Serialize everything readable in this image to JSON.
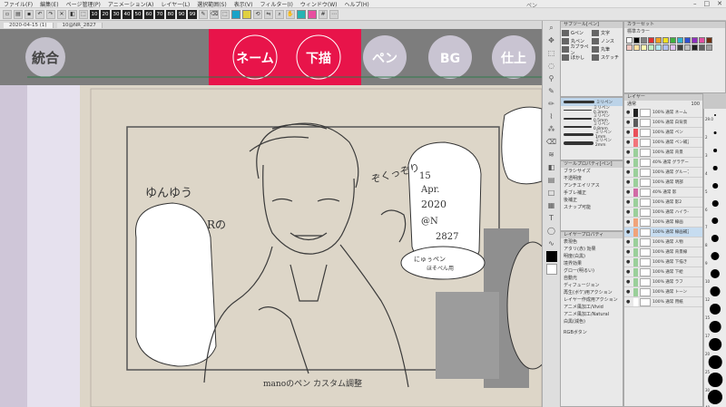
{
  "menubar": {
    "items": [
      "ファイル(F)",
      "編集(E)",
      "ページ管理(P)",
      "アニメーション(A)",
      "レイヤー(L)",
      "選択範囲(S)",
      "表示(V)",
      "フィルター(I)",
      "ウィンドウ(W)",
      "ヘルプ(H)"
    ],
    "title": "ペン"
  },
  "toolbar": {
    "brush_sizes": [
      "10",
      "20",
      "30",
      "40",
      "50",
      "60",
      "70",
      "80",
      "90",
      "99"
    ],
    "colors": {
      "fg": "#000000",
      "bg": "#ffffff"
    }
  },
  "canvas": {
    "tabs": [
      "2020-04-15 (1)",
      "10@NR_2827"
    ],
    "header_circles": [
      {
        "label": "統合",
        "active": false
      },
      {
        "label": "ネーム",
        "active": true
      },
      {
        "label": "下描",
        "active": true
      },
      {
        "label": "ペン",
        "active": false
      },
      {
        "label": "BG",
        "active": false
      },
      {
        "label": "仕上",
        "active": false
      }
    ],
    "notes": {
      "left": "ゆんゆう",
      "mid_left": "Rの",
      "top_right": "ぞくっぞり",
      "date": [
        "15",
        "Apr.",
        "2020",
        "@N",
        "2827"
      ],
      "bubble": [
        "にゅぅペン",
        "ほそぺん用"
      ],
      "bottom": "manoのペン カスタム調整"
    }
  },
  "sub_tool_panel": {
    "header": "サブツール[ペン]",
    "items": [
      {
        "label": "Gペン"
      },
      {
        "label": "文字"
      },
      {
        "label": "丸ペン"
      },
      {
        "label": "ノンス"
      },
      {
        "label": "カブラペン"
      },
      {
        "label": "丸筆"
      },
      {
        "label": "ぼかし"
      },
      {
        "label": "スケッチ"
      }
    ],
    "brushes": [
      "ミリペン",
      "ミリペン 0.3mm",
      "ミリペン 0.5mm",
      "ミリペン 0.8mm",
      "ミリペン 1mm",
      "ミリペン 2mm"
    ]
  },
  "tool_property": {
    "header": "ツールプロパティ[ペン]",
    "rows": [
      "ブラシサイズ",
      "不透明度",
      "アンチエイリアス",
      "手ブレ補正",
      "後補正",
      "スナップ可能"
    ]
  },
  "layer_property": {
    "header": "レイヤープロパティ",
    "rows": [
      "表現色",
      "アタリ(赤) 効果",
      "明度(白黒)",
      "境界効果",
      "グロー(明るい)",
      "自動光",
      "ディフュージョン",
      "再生(ボケ)用アクション",
      "レイヤー作成用アクション",
      "アニメ風加工/Vivid",
      "アニメ風加工/Natural",
      "白黒(減色)"
    ],
    "bottom": "RGBボタン"
  },
  "color_set": {
    "header": "カラーセット",
    "name": "標準カラー"
  },
  "layer_panel": {
    "header": "レイヤー",
    "blend": "通常",
    "opacity": "100",
    "layers": [
      {
        "name": "100% 通常 ネーム",
        "color": "#222222"
      },
      {
        "name": "100% 通常 白背景",
        "color": "#5b5b5b"
      },
      {
        "name": "100% 通常 ペン",
        "color": "#e94f58"
      },
      {
        "name": "100% 通常 ペン補正",
        "color": "#f2747b"
      },
      {
        "name": "100% 通常 背景",
        "color": "#9acf9a"
      },
      {
        "name": "40% 通常 グラデーション",
        "color": "#9acf9a"
      },
      {
        "name": "100% 通常 グループ",
        "color": "#9acf9a"
      },
      {
        "name": "100% 通常 明部",
        "color": "#9acf9a"
      },
      {
        "name": "40% 通常 影",
        "color": "#d16aa6"
      },
      {
        "name": "100% 通常 影2",
        "color": "#9acf9a"
      },
      {
        "name": "100% 通常 ハイライト",
        "color": "#9acf9a"
      },
      {
        "name": "100% 通常 線画",
        "color": "#f0a37a"
      },
      {
        "name": "100% 通常 線画補正",
        "color": "#f0a37a"
      },
      {
        "name": "100% 通常 人物",
        "color": "#9acf9a"
      },
      {
        "name": "100% 通常 背景線",
        "color": "#9acf9a"
      },
      {
        "name": "100% 通常 下描き",
        "color": "#9acf9a"
      },
      {
        "name": "100% 通常 下絵",
        "color": "#9acf9a"
      },
      {
        "name": "100% 通常 ラフ",
        "color": "#9acf9a"
      },
      {
        "name": "100% 通常 トーン",
        "color": "#9acf9a"
      },
      {
        "name": "100% 通常 用紙",
        "color": "#ffffff"
      }
    ]
  },
  "brush_size_panel": {
    "values": [
      "29.0",
      "2",
      "3",
      "4",
      "5",
      "6",
      "7",
      "8",
      "9",
      "10",
      "12",
      "15",
      "17",
      "20",
      "25",
      "30",
      "40"
    ]
  }
}
